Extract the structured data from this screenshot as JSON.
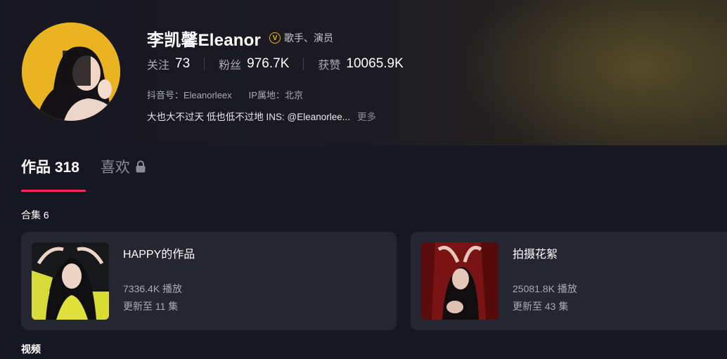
{
  "profile": {
    "name": "李凯馨Eleanor",
    "verify_badge": "V",
    "verify_text": "歌手、演员",
    "stats": [
      {
        "label": "关注",
        "value": "73"
      },
      {
        "label": "粉丝",
        "value": "976.7K"
      },
      {
        "label": "获赞",
        "value": "10065.9K"
      }
    ],
    "douyin_id": "抖音号：Eleanorleex",
    "ip_location": "IP属地：北京",
    "bio": "大也大不过天 低也低不过地 INS: @Eleanorlee...",
    "bio_more": "更多"
  },
  "tabs": {
    "works": "作品 318",
    "likes": "喜欢"
  },
  "collections": {
    "title": "合集 6",
    "items": [
      {
        "title": "HAPPY的作品",
        "plays": "7336.4K 播放",
        "updated": "更新至 11 集"
      },
      {
        "title": "拍摄花絮",
        "plays": "25081.8K 播放",
        "updated": "更新至 43 集"
      }
    ]
  },
  "videos_title": "视频",
  "colors": {
    "accent": "#fe2c55",
    "verify": "#f5b400",
    "background": "#161722",
    "card": "#252632"
  },
  "icons": {
    "verify": "verified-v-icon",
    "lock": "lock-icon"
  }
}
